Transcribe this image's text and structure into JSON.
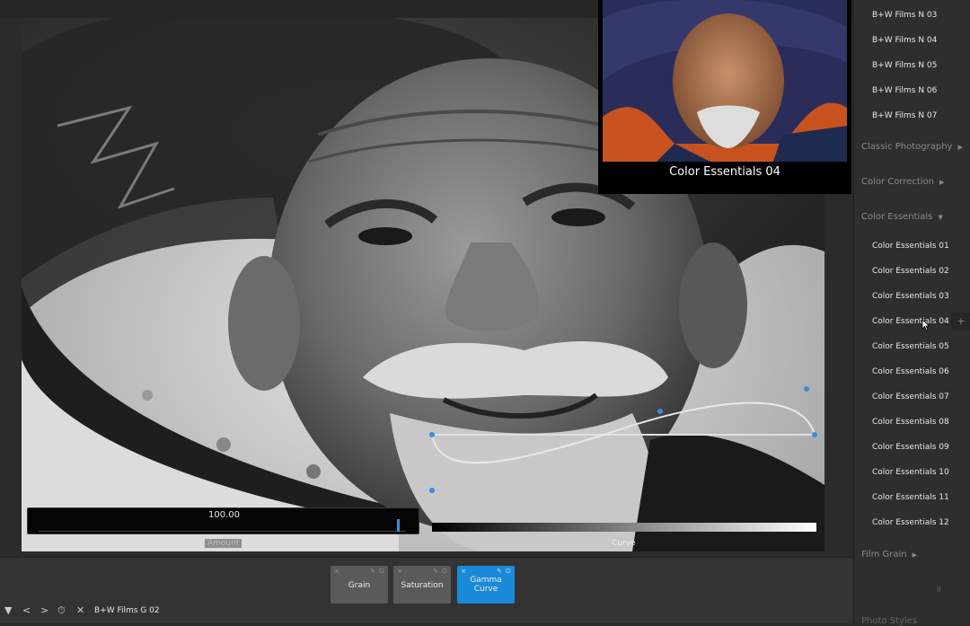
{
  "sidebar": {
    "top_items": [
      "B+W Films N 03",
      "B+W Films N 04",
      "B+W Films N 05",
      "B+W Films N 06",
      "B+W Films N 07"
    ],
    "categories": [
      {
        "label": "Classic Photography",
        "arrow": "▶"
      },
      {
        "label": "Color Correction",
        "arrow": "▶"
      },
      {
        "label": "Color Essentials",
        "arrow": "▼"
      }
    ],
    "color_essentials_items": [
      "Color Essentials 01",
      "Color Essentials 02",
      "Color Essentials 03",
      "Color Essentials 04",
      "Color Essentials 05",
      "Color Essentials 06",
      "Color Essentials 07",
      "Color Essentials 08",
      "Color Essentials 09",
      "Color Essentials 10",
      "Color Essentials 11",
      "Color Essentials 12"
    ],
    "film_grain": {
      "label": "Film Grain",
      "arrow": "▶"
    },
    "plus_symbol": "+",
    "pause_symbol": "II",
    "bottom_partial": "Photo Styles"
  },
  "preview": {
    "caption": "Color Essentials 04"
  },
  "amount": {
    "value": "100.00",
    "label": "Amount",
    "level": 0.97
  },
  "curve": {
    "label": "Curve"
  },
  "filters": [
    {
      "label": "Grain",
      "active": false
    },
    {
      "label": "Saturation",
      "active": false
    },
    {
      "label": "Gamma Curve",
      "active": true
    }
  ],
  "filter_icons": {
    "close": "×",
    "pin": "✎",
    "power": "⏻"
  },
  "nav": {
    "menu": "▼",
    "back": "<",
    "forward": ">",
    "reset": "⏱",
    "close": "✕",
    "preset_name": "B+W Films G 02"
  },
  "colors": {
    "accent": "#1a8ad8",
    "panel": "#2e2e2e",
    "curve_point": "#3a8fd8"
  }
}
